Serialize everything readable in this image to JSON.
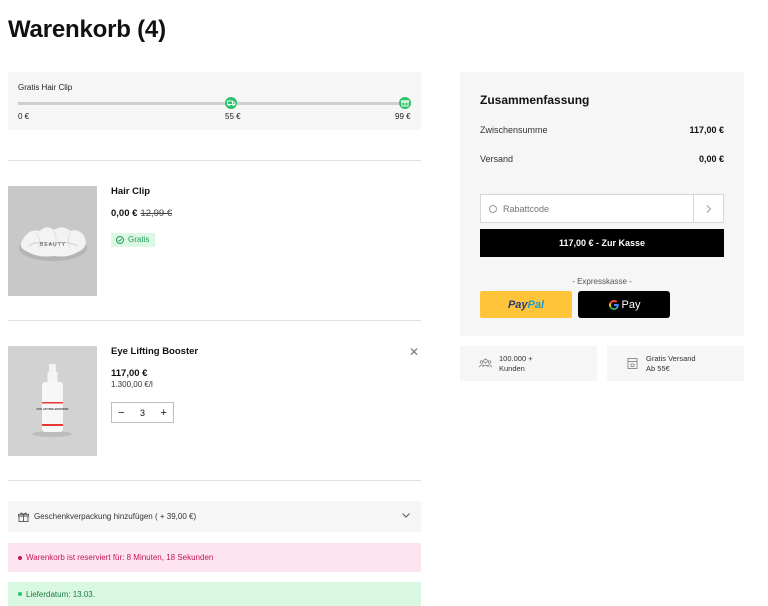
{
  "page": {
    "title": "Warenkorb (4)"
  },
  "progress": {
    "label": "Gratis Hair Clip",
    "ticks": [
      "0 €",
      "55 €",
      "99 €"
    ],
    "fraction": 1.0,
    "colors": {
      "track": "#cfcfcf",
      "marker": "#2bc36a"
    },
    "marker_icons": [
      "truck-icon",
      "gift-icon"
    ]
  },
  "items": [
    {
      "name": "Hair Clip",
      "price": "0,00 €",
      "old_price": "12,99 €",
      "badge": "Gratis",
      "image_text": "BEAUTY"
    },
    {
      "name": "Eye Lifting Booster",
      "price": "117,00 €",
      "unit_price": "1.300,00 €/l",
      "quantity": "3",
      "image_text": "EYE LIFTING BOOSTER"
    }
  ],
  "gift_wrap": {
    "label": "Geschenkverpackung hinzufügen ( + 39,00 €)"
  },
  "notices": {
    "reserved": "Warenkorb ist reserviert für: 8 Minuten, 18 Sekunden",
    "delivery": "Lieferdatum: 13.03."
  },
  "summary": {
    "title": "Zusammenfassung",
    "subtotal_label": "Zwischensumme",
    "subtotal_value": "117,00 €",
    "shipping_label": "Versand",
    "shipping_value": "0,00 €",
    "coupon_placeholder": "Rabattcode",
    "checkout_label": "117,00 € - Zur Kasse",
    "express_label": "- Expresskasse -",
    "paypal_a": "Pay",
    "paypal_b": "Pal",
    "gpay_g": "G",
    "gpay_label": "Pay"
  },
  "trust": [
    {
      "line1": "100.000 +",
      "line2": "Kunden"
    },
    {
      "line1": "Gratis Versand",
      "line2": "Ab 55€"
    }
  ],
  "colors": {
    "success": "#2bc36a",
    "reserved_bg": "#fde4f0",
    "reserved_text": "#c2185b",
    "delivery_bg": "#d9f8e2",
    "delivery_text": "#1f7a3f"
  }
}
